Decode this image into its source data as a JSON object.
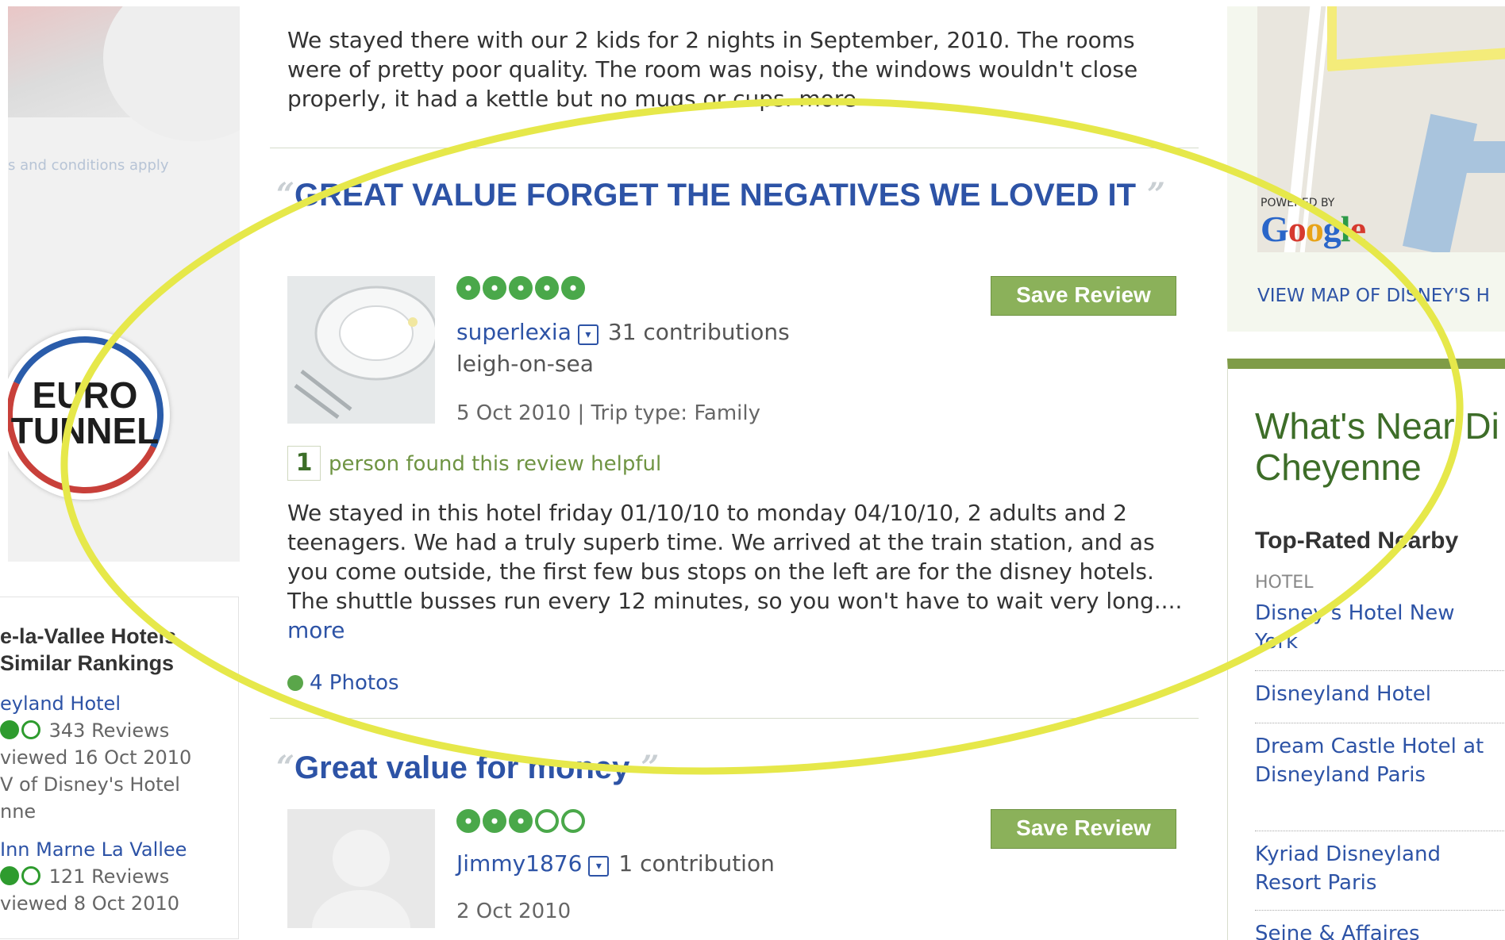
{
  "left": {
    "terms_text": "s and conditions apply",
    "logo_line1": "EURO",
    "logo_line2": "TUNNEL",
    "similar_title_line1": "e-la-Vallee Hotels",
    "similar_title_line2": "Similar Rankings",
    "hotels": [
      {
        "name": "eyland Hotel",
        "reviews": "343 Reviews",
        "reviewed": "viewed 16 Oct 2010",
        "near": "V of Disney's Hotel",
        "near2": "nne"
      },
      {
        "name": "Inn Marne La Vallee",
        "reviews": "121 Reviews",
        "reviewed": "viewed 8 Oct 2010"
      }
    ]
  },
  "reviews": {
    "prev_excerpt": "We stayed there with our 2 kids for 2 nights in September, 2010. The rooms were of pretty poor quality. The room was noisy, the windows wouldn't close properly, it had a kettle but no mugs or cups. more",
    "items": [
      {
        "title": "GREAT VALUE FORGET THE NEGATIVES WE LOVED IT",
        "rating": 5,
        "save_label": "Save Review",
        "username": "superlexia",
        "contributions": "31 contributions",
        "location": "leigh-on-sea",
        "date_trip": "5 Oct 2010 | Trip type: Family",
        "helpful_count": "1",
        "helpful_text": "person found this review helpful",
        "body": "We stayed in this hotel friday 01/10/10 to monday 04/10/10, 2 adults and 2 teenagers. We had a truly superb time. We arrived at the train station, and as you come outside, the first few bus stops on the left are for the disney hotels. The shuttle busses run every 12 minutes, so you won't have to wait very long....",
        "more_label": "more",
        "photos_label": "4 Photos"
      },
      {
        "title": "Great value for money",
        "rating": 3,
        "save_label": "Save Review",
        "username": "Jimmy1876",
        "contributions": "1 contribution",
        "date_trip": "2 Oct 2010"
      }
    ]
  },
  "right": {
    "powered_by": "POWERED BY",
    "google": [
      "G",
      "o",
      "o",
      "g",
      "l",
      "e"
    ],
    "view_map": "VIEW MAP OF DISNEY'S H",
    "near_title_line1": "What's Near Di",
    "near_title_line2": "Cheyenne",
    "top_rated": "Top-Rated Nearby",
    "category": "HOTEL",
    "nearby": [
      "Disney's Hotel New York",
      "Disneyland Hotel",
      "Dream Castle Hotel at Disneyland Paris",
      "Kyriad Disneyland Resort Paris",
      "Seine & Affaires"
    ]
  },
  "colors": {
    "link": "#2d53a6",
    "accent_green": "#8bb15a",
    "bubble_green": "#4aa84a",
    "highlight_ellipse": "#e6e84a"
  }
}
